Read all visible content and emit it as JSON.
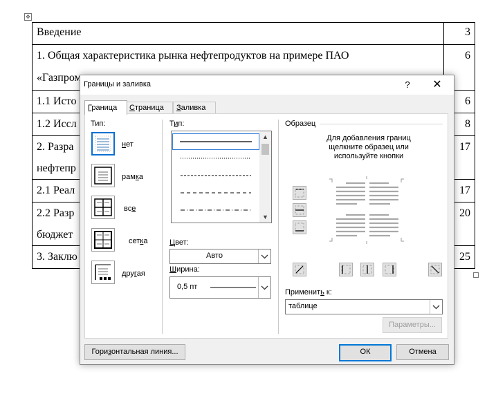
{
  "document": {
    "rows": [
      {
        "text": "Введение",
        "page": "3"
      },
      {
        "text": "1. Общая характеристика рынка нефтепродуктов на примере ПАО",
        "text2": "«Газпром»",
        "page": "6"
      },
      {
        "text": "1.1 Исто",
        "page": "6"
      },
      {
        "text": "1.2 Иссл",
        "page": "8"
      },
      {
        "text": "2. Разра",
        "text2": "нефтепр",
        "page": "17"
      },
      {
        "text": "2.1 Реал",
        "page": "17"
      },
      {
        "text": "2.2 Разр",
        "text2": "бюджет",
        "page": "20"
      },
      {
        "text": "3. Заклю",
        "page": "25"
      }
    ]
  },
  "dialog": {
    "title": "Границы и заливка",
    "help": "?",
    "close": "✕",
    "tabs": [
      {
        "label": "Граница",
        "accel": "Г",
        "rest": "раница",
        "active": true
      },
      {
        "label": "Страница",
        "accel": "С",
        "rest": "траница",
        "active": false
      },
      {
        "label": "Заливка",
        "accel": "З",
        "rest": "аливка",
        "active": false
      }
    ],
    "setting": {
      "label": "Тип:",
      "items": [
        {
          "label": "нет",
          "accel": "н",
          "rest": "ет",
          "icon": "border-none-icon"
        },
        {
          "label": "рамка",
          "pre": "рам",
          "accel": "к",
          "post": "а",
          "icon": "border-box-icon"
        },
        {
          "label": "все",
          "pre": "вс",
          "accel": "е",
          "post": "",
          "icon": "border-all-icon"
        },
        {
          "label": "сетка",
          "pre": "сет",
          "accel": "к",
          "post": "а",
          "icon": "border-grid-icon"
        },
        {
          "label": "другая",
          "pre": "дру",
          "accel": "г",
          "post": "ая",
          "icon": "border-custom-icon"
        }
      ]
    },
    "style": {
      "label": "Тип:",
      "accel": "и"
    },
    "color": {
      "label": "Цвет:",
      "accel": "Ц",
      "rest": "вет:",
      "value": "Авто"
    },
    "width": {
      "label": "Ширина:",
      "accel": "Ш",
      "rest": "ирина:",
      "value": "0,5 пт"
    },
    "preview": {
      "label": "Образец",
      "hint": "Для добавления границ щелкните образец или используйте кнопки"
    },
    "apply_to": {
      "label": "Применить к:",
      "pre": "Применит",
      "accel": "ь",
      "post": " к:",
      "value": "таблице"
    },
    "buttons": {
      "options": "Параметры...",
      "horizontal_line": "Горизонтальная линия...",
      "hl_pre": "Гори",
      "hl_accel": "з",
      "hl_post": "онтальная линия...",
      "ok": "ОК",
      "cancel": "Отмена"
    }
  }
}
